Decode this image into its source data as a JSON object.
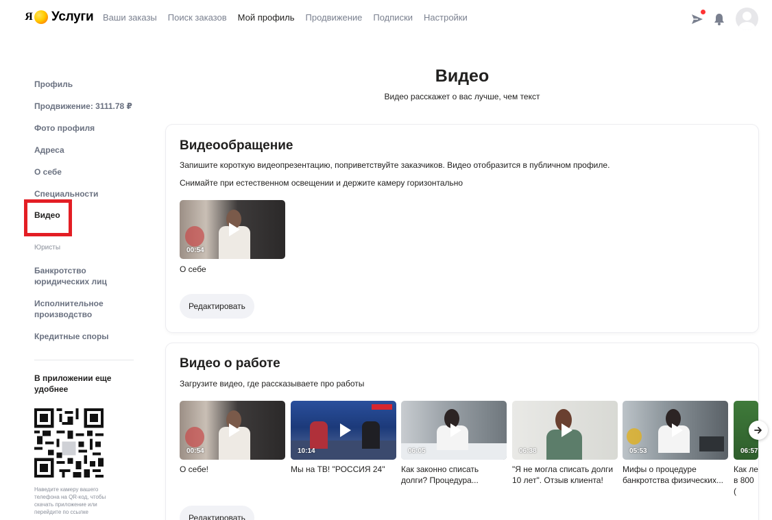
{
  "header": {
    "logo_ya": "Я",
    "logo_text": "Услуги",
    "nav": [
      {
        "label": "Ваши заказы",
        "active": false
      },
      {
        "label": "Поиск заказов",
        "active": false
      },
      {
        "label": "Мой профиль",
        "active": true
      },
      {
        "label": "Продвижение",
        "active": false
      },
      {
        "label": "Подписки",
        "active": false
      },
      {
        "label": "Настройки",
        "active": false
      }
    ],
    "icons": [
      "send-icon",
      "bell-icon",
      "avatar"
    ],
    "notification_color": "#ff3333"
  },
  "sidebar": {
    "items": [
      {
        "label": "Профиль"
      },
      {
        "label": "Продвижение: 3111.78 ₽"
      },
      {
        "label": "Фото профиля"
      },
      {
        "label": "Адреса"
      },
      {
        "label": "О себе"
      },
      {
        "label": "Специальности"
      },
      {
        "label": "Видео",
        "active": true
      }
    ],
    "group_label": "Юристы",
    "group_items": [
      {
        "label": "Банкротство юридических лиц"
      },
      {
        "label": "Исполнительное производство"
      },
      {
        "label": "Кредитные споры"
      }
    ],
    "app_title": "В приложении еще удобнее",
    "qr_hint": "Наведите камеру вашего телефона на QR-код, чтобы скачать приложение или перейдите по ссылке",
    "highlight_color": "#e31e24"
  },
  "main": {
    "title": "Видео",
    "subtitle": "Видео расскажет о вас лучше, чем текст",
    "intro_card": {
      "title": "Видеообращение",
      "text1": "Запишите короткую видеопрезентацию, поприветствуйте заказчиков. Видео отобразится в публичном профиле.",
      "text2": "Снимайте при естественном освещении и держите камеру горизонтально",
      "video": {
        "duration": "00:54",
        "caption": "О себе"
      },
      "edit_label": "Редактировать"
    },
    "work_card": {
      "title": "Видео о работе",
      "text": "Загрузите видео, где рассказываете про работы",
      "videos": [
        {
          "duration": "00:54",
          "caption": "О себе!"
        },
        {
          "duration": "10:14",
          "caption": "Мы на ТВ! \"РОССИЯ 24\""
        },
        {
          "duration": "06:05",
          "caption": "Как законно списать долги? Процедура..."
        },
        {
          "duration": "06:38",
          "caption": "\"Я не могла списать долги 10 лет\". Отзыв клиента!"
        },
        {
          "duration": "05:53",
          "caption": "Мифы о процедуре банкротства физических..."
        },
        {
          "duration": "06:57",
          "caption": "Как ле в 800 ("
        }
      ],
      "edit_label": "Редактировать"
    }
  }
}
